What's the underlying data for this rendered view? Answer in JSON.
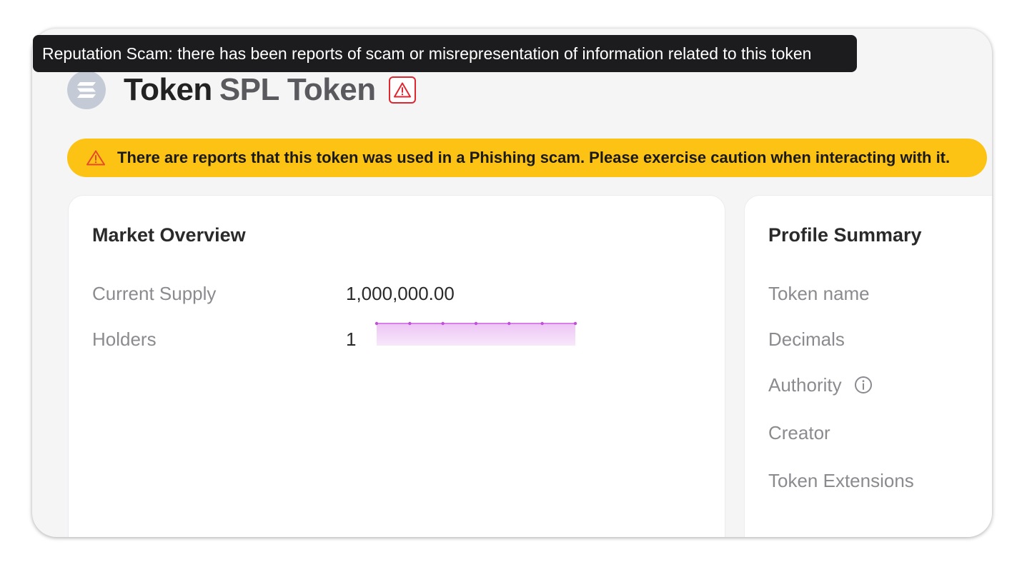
{
  "tooltip": {
    "text": "Reputation Scam: there has been reports of scam or misrepresentation of information related to this token"
  },
  "header": {
    "logo_icon": "solana-icon",
    "title_prefix": "Token",
    "title_name": "SPL Token",
    "warning_icon": "warning-triangle-icon",
    "warning_color": "#e0262f"
  },
  "banner": {
    "icon": "warning-triangle-icon",
    "text": "There are reports that this token was used in a Phishing scam. Please exercise caution when interacting with it.",
    "background": "#fcc214"
  },
  "market_overview": {
    "title": "Market Overview",
    "rows": [
      {
        "label": "Current Supply",
        "value": "1,000,000.00"
      },
      {
        "label": "Holders",
        "value": "1"
      }
    ],
    "holders_sparkline": {
      "color": "#d77ee8",
      "points": [
        1,
        1,
        1,
        1,
        1,
        1,
        1
      ]
    }
  },
  "profile_summary": {
    "title": "Profile Summary",
    "rows": [
      {
        "label": "Token name"
      },
      {
        "label": "Decimals"
      },
      {
        "label": "Authority",
        "icon": "info-circle-icon"
      },
      {
        "label": "Creator"
      },
      {
        "label": "Token Extensions"
      }
    ]
  }
}
